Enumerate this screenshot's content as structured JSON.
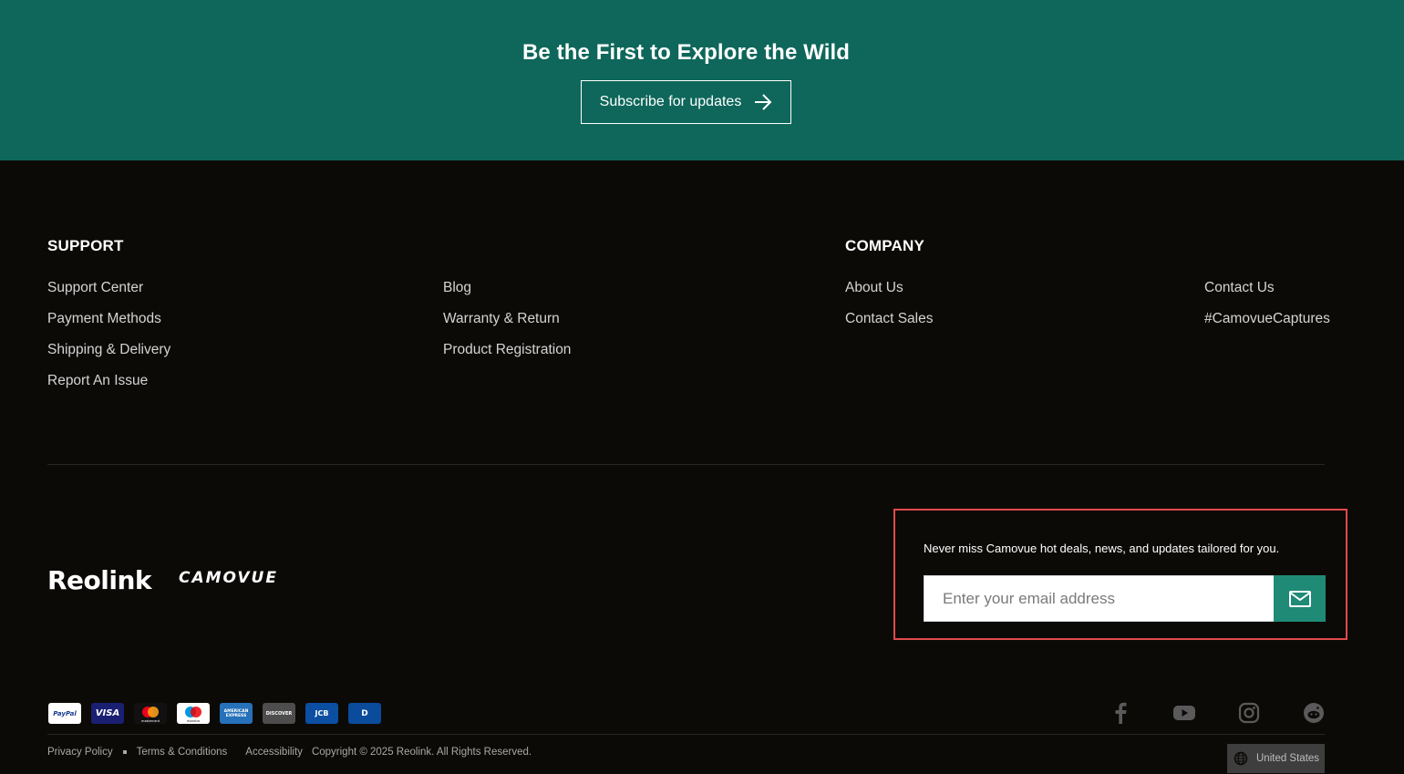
{
  "hero": {
    "title": "Be the First to Explore the Wild",
    "subscribe_label": "Subscribe for updates"
  },
  "support": {
    "heading": "SUPPORT",
    "col1": [
      "Support Center",
      "Payment Methods",
      "Shipping & Delivery",
      "Report An Issue"
    ],
    "col2": [
      "Blog",
      "Warranty & Return",
      "Product Registration"
    ]
  },
  "company": {
    "heading": "COMPANY",
    "col1": [
      "About Us",
      "Contact Sales"
    ],
    "col2": [
      "Contact Us",
      "#CamovueCaptures"
    ]
  },
  "brands": {
    "reolink": "Reolink",
    "camovue": "CAMOVUE"
  },
  "newsletter": {
    "text": "Never miss Camovue hot deals, news, and updates tailored for you.",
    "placeholder": "Enter your email address"
  },
  "payments": {
    "paypal": "PayPal",
    "visa": "VISA",
    "mastercard": "mastercard",
    "maestro": "maestro",
    "amex": "AMERICAN EXPRESS",
    "discover": "DISCOVER",
    "jcb": "JCB",
    "diners": "D"
  },
  "socials": [
    "facebook-icon",
    "youtube-icon",
    "instagram-icon",
    "reddit-icon"
  ],
  "legal": {
    "privacy": "Privacy Policy",
    "terms": "Terms & Conditions",
    "accessibility": "Accessibility",
    "copyright": "Copyright © 2025 Reolink. All Rights Reserved."
  },
  "region": {
    "label": "United States"
  },
  "colors": {
    "hero_bg": "#0e675a",
    "footer_bg": "#0c0a07",
    "accent": "#1f8a76",
    "highlight_border": "#e04a4a"
  }
}
